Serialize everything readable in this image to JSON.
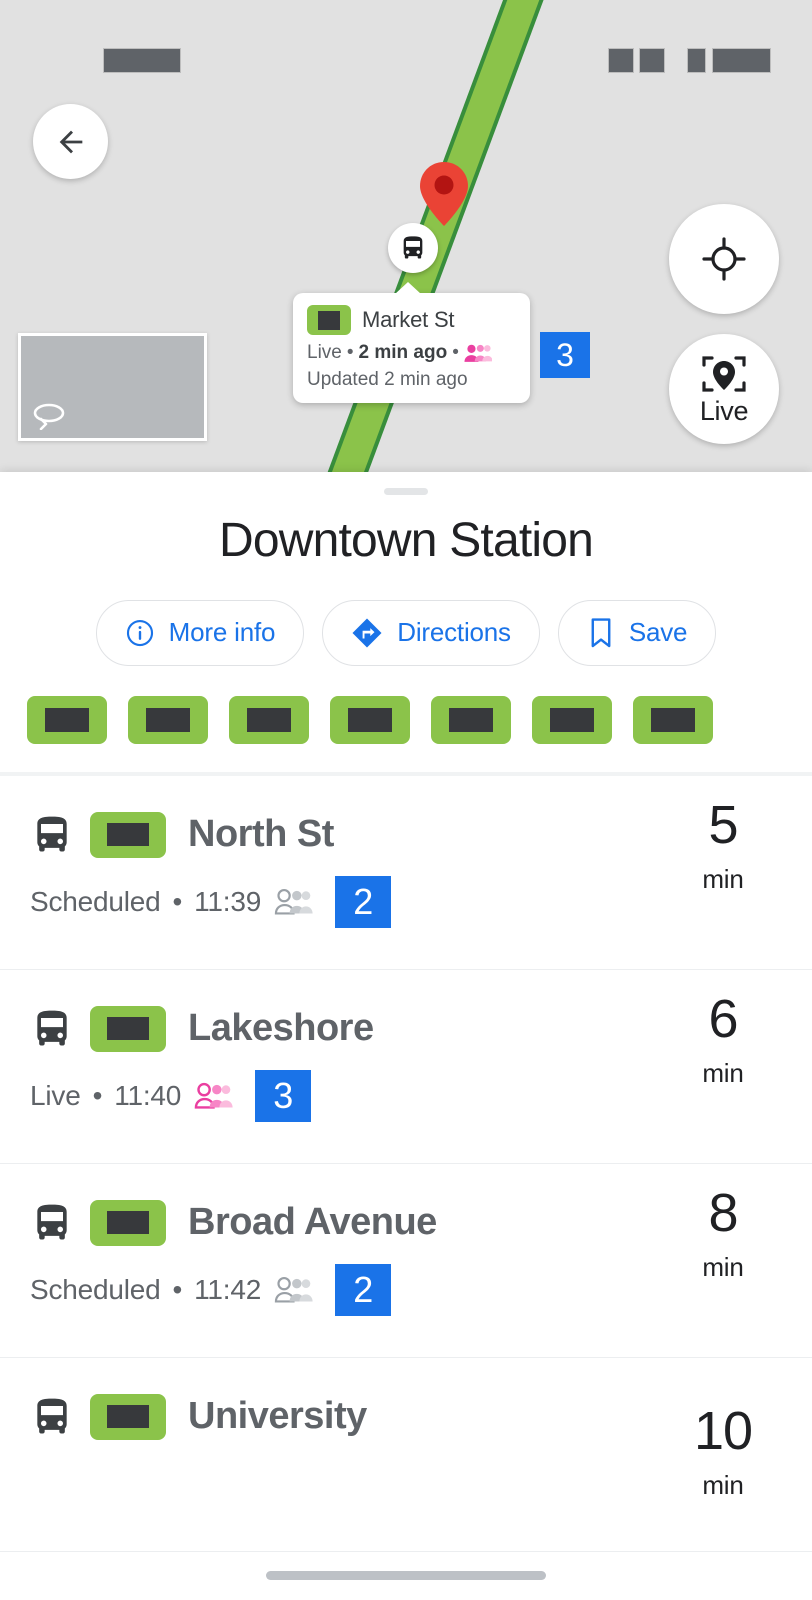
{
  "colors": {
    "route_green": "#8bc34a",
    "route_green_dark": "#388e3c",
    "accent_blue": "#1a73e8",
    "pin_red": "#ea4335",
    "crowd_live_pink": "#ea3fa0",
    "crowd_scheduled_gray": "#9aa0a6",
    "map_bg": "#e1e1e1",
    "text_primary": "#202124",
    "text_secondary": "#5f6368"
  },
  "status_bar": {
    "left_indicator": "",
    "right_indicators": [
      "",
      "",
      "",
      ""
    ]
  },
  "map": {
    "back_button": {
      "icon": "arrow-left-icon"
    },
    "locate_button": {
      "icon": "my-location-icon"
    },
    "live_view_button": {
      "icon": "live-view-pin-icon",
      "label": "Live"
    },
    "street_view_thumbnail": {
      "icon": "rotate-360-icon"
    },
    "vehicle_marker": {
      "icon": "bus-icon"
    },
    "place_pin": {
      "icon": "map-pin-icon"
    },
    "callout": {
      "route_badge": "route-badge-redacted",
      "title": "Market St",
      "status": "Live",
      "separator": "•",
      "elapsed": "2 min ago",
      "trailing_separator": "•",
      "crowding_icon": "crowding-pink-icon",
      "updated": "Updated 2 min ago",
      "crowd_level": "3"
    }
  },
  "sheet": {
    "title": "Downtown Station",
    "actions": [
      {
        "label": "More info",
        "icon": "info-circle-icon"
      },
      {
        "label": "Directions",
        "icon": "directions-diamond-icon"
      },
      {
        "label": "Save",
        "icon": "bookmark-icon"
      }
    ],
    "route_badges": [
      "route-badge-redacted",
      "route-badge-redacted",
      "route-badge-redacted",
      "route-badge-redacted",
      "route-badge-redacted",
      "route-badge-redacted",
      "route-badge-redacted"
    ],
    "departures": [
      {
        "vehicle_icon": "bus-icon",
        "route_badge": "route-badge-redacted",
        "destination": "North St",
        "status": "Scheduled",
        "separator": "•",
        "time": "11:39",
        "crowding_icon": "crowding-gray-icon",
        "crowd_level": "2",
        "eta_value": "5",
        "eta_unit": "min"
      },
      {
        "vehicle_icon": "bus-icon",
        "route_badge": "route-badge-redacted",
        "destination": "Lakeshore",
        "status": "Live",
        "separator": "•",
        "time": "11:40",
        "crowding_icon": "crowding-pink-icon",
        "crowd_level": "3",
        "eta_value": "6",
        "eta_unit": "min"
      },
      {
        "vehicle_icon": "bus-icon",
        "route_badge": "route-badge-redacted",
        "destination": "Broad Avenue",
        "status": "Scheduled",
        "separator": "•",
        "time": "11:42",
        "crowding_icon": "crowding-gray-icon",
        "crowd_level": "2",
        "eta_value": "8",
        "eta_unit": "min"
      },
      {
        "vehicle_icon": "bus-icon",
        "route_badge": "route-badge-redacted",
        "destination": "University",
        "status": "",
        "separator": "",
        "time": "",
        "crowding_icon": "",
        "crowd_level": "",
        "eta_value": "10",
        "eta_unit": "min"
      }
    ]
  }
}
